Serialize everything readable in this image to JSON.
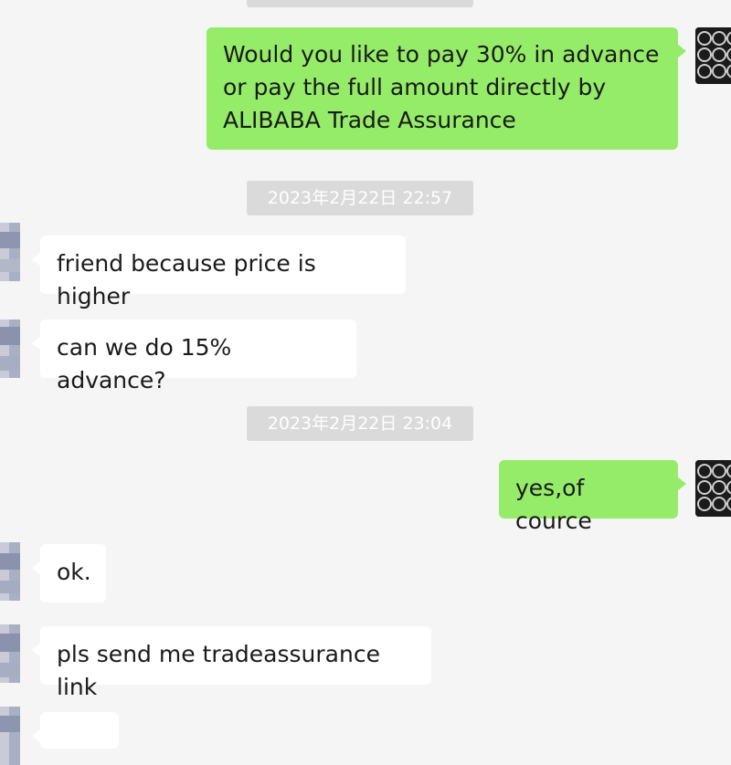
{
  "chat": {
    "messages": [
      {
        "kind": "outgoing",
        "text": "Would you like to pay 30% in advance\nor pay the full amount directly by\nALIBABA Trade Assurance"
      },
      {
        "kind": "timestamp",
        "text": "2023年2月22日 22:57"
      },
      {
        "kind": "incoming",
        "text": "friend because price is higher"
      },
      {
        "kind": "incoming",
        "text": "can we do 15% advance?"
      },
      {
        "kind": "timestamp",
        "text": "2023年2月22日 23:04"
      },
      {
        "kind": "outgoing",
        "text": "yes,of cource"
      },
      {
        "kind": "incoming",
        "text": "ok."
      },
      {
        "kind": "incoming",
        "text": "pls send me tradeassurance link"
      },
      {
        "kind": "incoming",
        "text": ""
      }
    ]
  },
  "colors": {
    "background": "#f5f5f5",
    "outgoing_bubble": "#95ec69",
    "incoming_bubble": "#ffffff",
    "timestamp_pill": "#dadada"
  },
  "icons": {
    "self_avatar": "steel-pipes-avatar-icon",
    "contact_avatar": "pixelated-avatar-icon"
  }
}
